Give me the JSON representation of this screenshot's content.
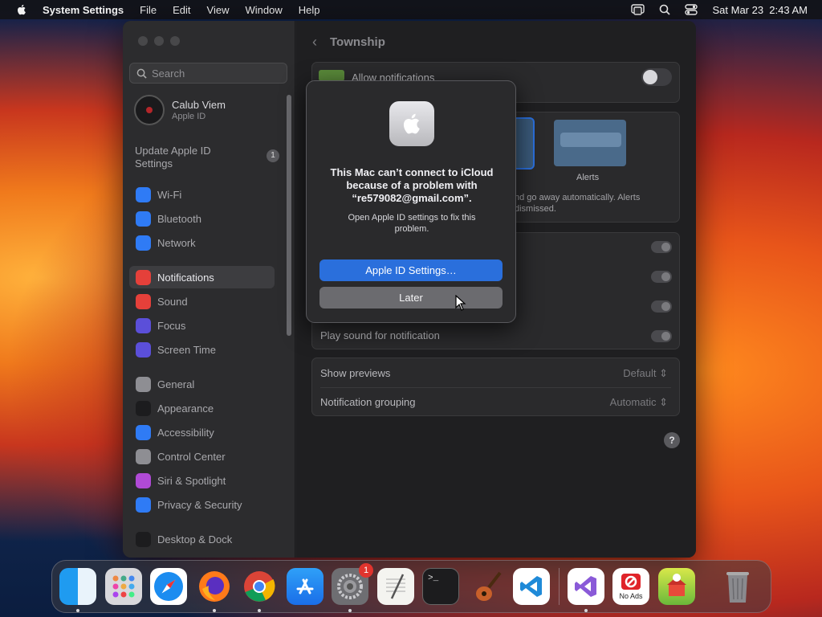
{
  "menubar": {
    "app_name": "System Settings",
    "menus": [
      "File",
      "Edit",
      "View",
      "Window",
      "Help"
    ],
    "clock": "Sat Mar 23  2:43 AM"
  },
  "sidebar": {
    "search_placeholder": "Search",
    "profile": {
      "name": "Calub Viem",
      "subtitle": "Apple ID"
    },
    "update": {
      "label": "Update Apple ID Settings",
      "badge": "1"
    },
    "groups": [
      [
        {
          "label": "Wi-Fi",
          "icon": "wifi-icon",
          "color": "#2f7bf5"
        },
        {
          "label": "Bluetooth",
          "icon": "bluetooth-icon",
          "color": "#2f7bf5"
        },
        {
          "label": "Network",
          "icon": "globe-icon",
          "color": "#2f7bf5"
        }
      ],
      [
        {
          "label": "Notifications",
          "icon": "bell-icon",
          "color": "#e5403a",
          "active": true
        },
        {
          "label": "Sound",
          "icon": "speaker-icon",
          "color": "#e5403a"
        },
        {
          "label": "Focus",
          "icon": "moon-icon",
          "color": "#5b4fd9"
        },
        {
          "label": "Screen Time",
          "icon": "hourglass-icon",
          "color": "#5b4fd9"
        }
      ],
      [
        {
          "label": "General",
          "icon": "gear-icon",
          "color": "#8e8e93"
        },
        {
          "label": "Appearance",
          "icon": "appearance-icon",
          "color": "#1c1c1e"
        },
        {
          "label": "Accessibility",
          "icon": "accessibility-icon",
          "color": "#2f7bf5"
        },
        {
          "label": "Control Center",
          "icon": "control-center-icon",
          "color": "#8e8e93"
        },
        {
          "label": "Siri & Spotlight",
          "icon": "siri-icon",
          "color": "#b04ad6"
        },
        {
          "label": "Privacy & Security",
          "icon": "hand-icon",
          "color": "#2f7bf5"
        }
      ],
      [
        {
          "label": "Desktop & Dock",
          "icon": "dock-icon",
          "color": "#1c1c1e"
        }
      ]
    ]
  },
  "content": {
    "title": "Township",
    "allow_notifications": "Allow notifications",
    "alert_style_label": "Alerts",
    "alert_desc_line1": "nd go away automatically. Alerts",
    "alert_desc_line2": "dismissed.",
    "play_sound": "Play sound for notification",
    "show_previews": {
      "label": "Show previews",
      "value": "Default"
    },
    "grouping": {
      "label": "Notification grouping",
      "value": "Automatic"
    },
    "help": "?"
  },
  "dialog": {
    "message": "This Mac can’t connect to iCloud because of a problem with “re579082@gmail.com”.",
    "info": "Open Apple ID settings to fix this problem.",
    "primary_button": "Apple ID Settings…",
    "secondary_button": "Later"
  },
  "dock": {
    "items": [
      {
        "name": "finder-icon",
        "running": true
      },
      {
        "name": "launchpad-icon"
      },
      {
        "name": "safari-icon"
      },
      {
        "name": "firefox-icon",
        "running": true
      },
      {
        "name": "chrome-icon",
        "running": true
      },
      {
        "name": "app-store-icon"
      },
      {
        "name": "system-settings-icon",
        "badge": "1",
        "running": true
      },
      {
        "name": "textedit-icon"
      },
      {
        "name": "terminal-icon"
      },
      {
        "name": "garageband-icon"
      },
      {
        "name": "vscode-icon"
      }
    ],
    "recent": [
      {
        "name": "visual-studio-icon",
        "running": true
      },
      {
        "name": "no-ads-icon",
        "label": "No Ads"
      },
      {
        "name": "township-icon"
      }
    ],
    "trash": "trash-icon"
  }
}
